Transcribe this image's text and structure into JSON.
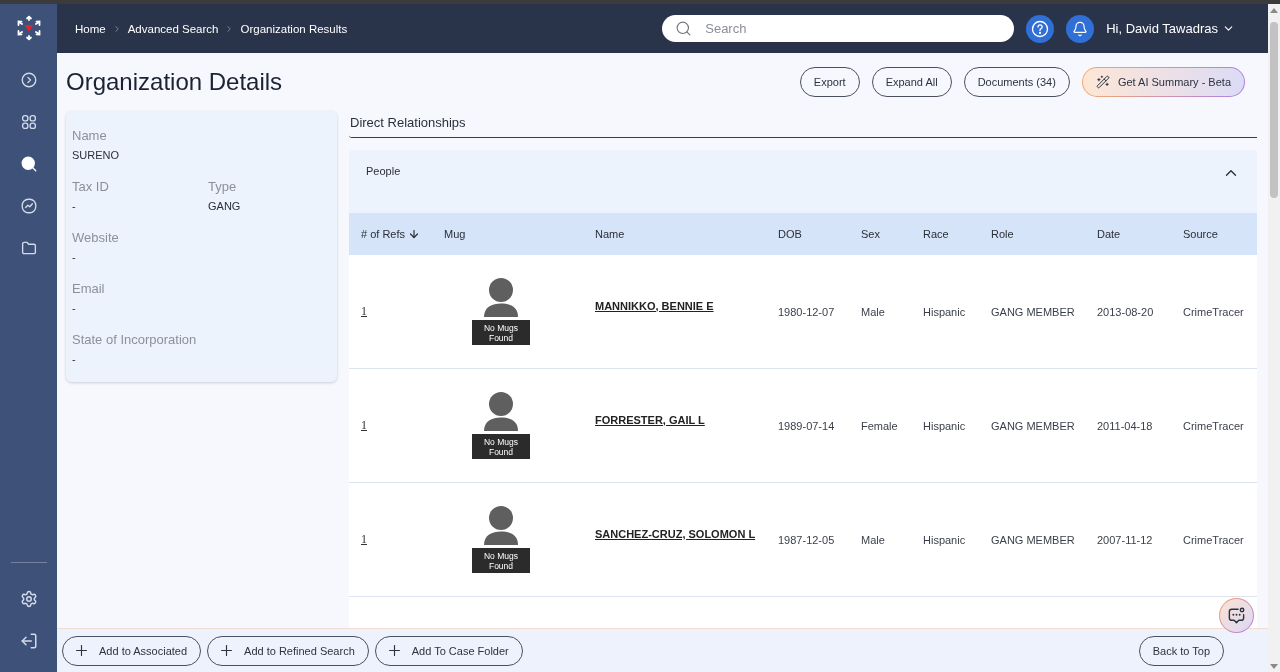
{
  "sidebar": {
    "nav_items": [
      {
        "kind": "expand",
        "selected": false
      },
      {
        "kind": "dashboard",
        "selected": false
      },
      {
        "kind": "search",
        "selected": true
      },
      {
        "kind": "analytics",
        "selected": false
      },
      {
        "kind": "folder",
        "selected": false
      }
    ],
    "bottom_items": [
      {
        "kind": "settings"
      },
      {
        "kind": "logout"
      }
    ]
  },
  "header": {
    "breadcrumbs": [
      "Home",
      "Advanced Search",
      "Organization Results"
    ],
    "search": {
      "placeholder": "Search"
    },
    "user": "Hi, David Tawadras"
  },
  "page": {
    "title": "Organization Details",
    "actions": [
      {
        "label": "Export",
        "kind": "outline"
      },
      {
        "label": "Expand All",
        "kind": "outline"
      },
      {
        "label": "Documents (34)",
        "kind": "outline"
      },
      {
        "label": "Get AI Summary - Beta",
        "kind": "gradient"
      }
    ]
  },
  "details": {
    "rows": [
      {
        "fields": [
          {
            "label": "Name",
            "value": "SURENO"
          }
        ]
      },
      {
        "fields": [
          {
            "label": "Tax ID",
            "value": "-"
          },
          {
            "label": "Type",
            "value": "GANG"
          }
        ]
      },
      {
        "fields": [
          {
            "label": "Website",
            "value": "-"
          }
        ]
      },
      {
        "fields": [
          {
            "label": "Email",
            "value": "-"
          }
        ]
      },
      {
        "fields": [
          {
            "label": "State of Incorporation",
            "value": "-"
          }
        ]
      }
    ]
  },
  "relationships": {
    "heading": "Direct Relationships",
    "sections": [
      {
        "title": "People",
        "expanded": true,
        "table": {
          "columns": [
            {
              "label": "# of Refs",
              "sorted": true
            },
            {
              "label": "Mug",
              "sorted": false
            },
            {
              "label": "Name",
              "sorted": false
            },
            {
              "label": "DOB",
              "sorted": false
            },
            {
              "label": "Sex",
              "sorted": false
            },
            {
              "label": "Race",
              "sorted": false
            },
            {
              "label": "Role",
              "sorted": false
            },
            {
              "label": "Date",
              "sorted": false
            },
            {
              "label": "Source",
              "sorted": false
            }
          ],
          "rows": [
            {
              "refs": "1",
              "mug_caption": "No Mugs Found",
              "name": "MANNIKKO, BENNIE E",
              "dob": "1980-12-07",
              "sex": "Male",
              "race": "Hispanic",
              "role": "GANG MEMBER",
              "date": "2013-08-20",
              "source": "CrimeTracer"
            },
            {
              "refs": "1",
              "mug_caption": "No Mugs Found",
              "name": "FORRESTER, GAIL L",
              "dob": "1989-07-14",
              "sex": "Female",
              "race": "Hispanic",
              "role": "GANG MEMBER",
              "date": "2011-04-18",
              "source": "CrimeTracer"
            },
            {
              "refs": "1",
              "mug_caption": "No Mugs Found",
              "name": "SANCHEZ-CRUZ, SOLOMON L",
              "dob": "1987-12-05",
              "sex": "Male",
              "race": "Hispanic",
              "role": "GANG MEMBER",
              "date": "2007-11-12",
              "source": "CrimeTracer"
            }
          ]
        }
      }
    ]
  },
  "footer": {
    "actions": [
      "Add to Associated",
      "Add to Refined Search",
      "Add To Case Folder"
    ],
    "back_to_top": "Back to Top"
  }
}
